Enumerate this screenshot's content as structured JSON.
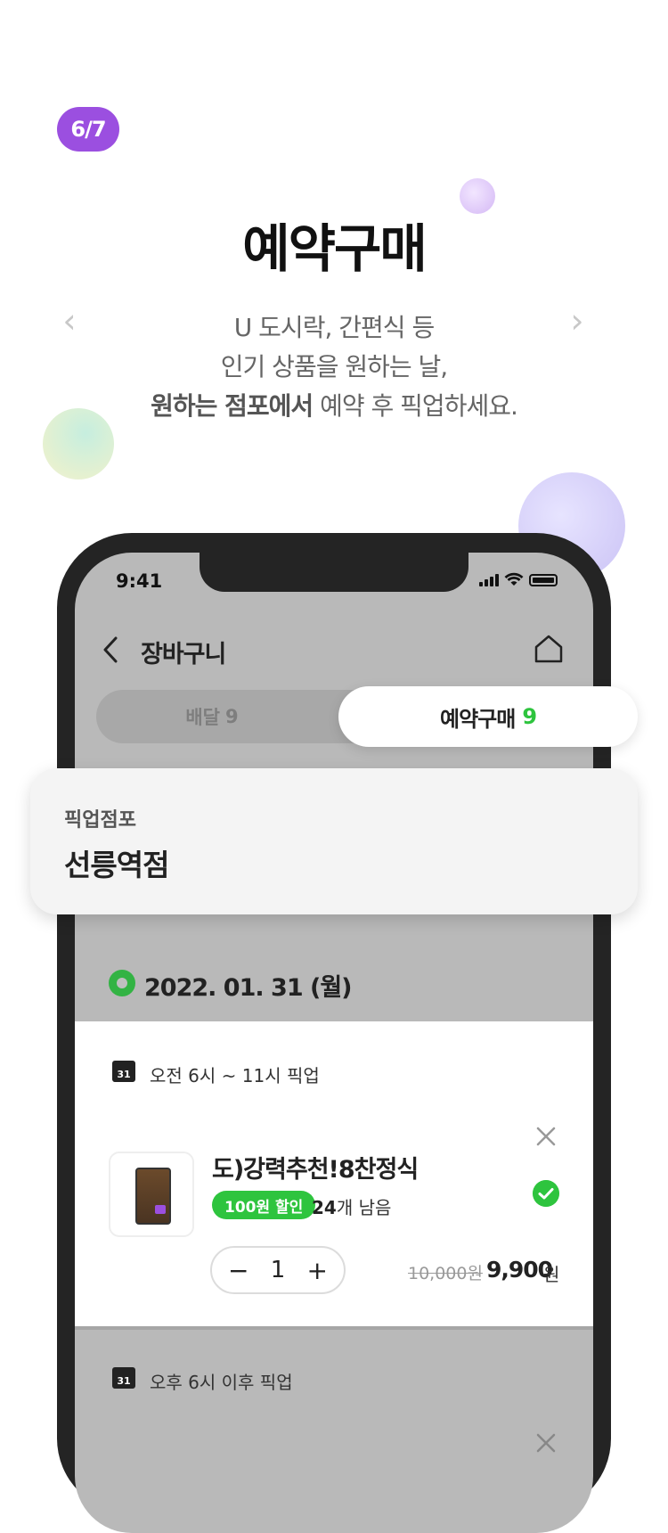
{
  "badge": "6/7",
  "headline": "예약구매",
  "description": {
    "line1": "U 도시락, 간편식 등",
    "line2": "인기 상품을 원하는 날,",
    "line3_bold": "원하는 점포에서",
    "line3_rest": " 예약 후 픽업하세요."
  },
  "nav": {
    "prev": "‹",
    "next": "›"
  },
  "phone": {
    "status_time": "9:41",
    "header": {
      "title": "장바구니"
    },
    "tabs": {
      "delivery_label": "배달",
      "delivery_count": "9",
      "reserve_label": "예약구매",
      "reserve_count": "9"
    },
    "pickup": {
      "label": "픽업점포",
      "store": "선릉역점"
    },
    "date": "2022. 01. 31 (월)",
    "slots": [
      {
        "label": "오전 6시 ~ 11시 픽업",
        "item": {
          "name": "도)강력추천!8찬정식",
          "discount_badge": "100원 할인",
          "remaining_count": "24",
          "remaining_suffix": "개 남음",
          "quantity": "1",
          "original_price": "10,000원",
          "price": "9,900",
          "currency": "원"
        }
      },
      {
        "label": "오후 6시 이후 픽업"
      }
    ],
    "calendar_day": "31"
  },
  "colors": {
    "brand_purple": "#9b4fe0",
    "accent_green": "#2ec43e",
    "text_dark": "#222222"
  }
}
